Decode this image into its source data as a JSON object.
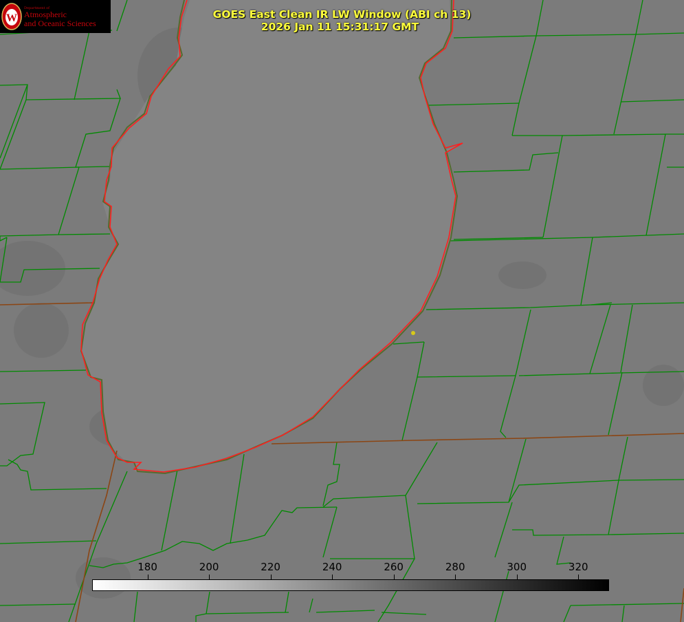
{
  "logo": {
    "department": "Department of",
    "line1": "Atmospheric",
    "line2": "and Oceanic Sciences",
    "seal_letter": "W",
    "seal_icon": "uw-crest-icon",
    "colors": {
      "background": "#000000",
      "text": "#c5050c",
      "seal": "#c5050c",
      "seal_gold": "#d9b65a"
    }
  },
  "title": {
    "line1": "GOES East Clean IR LW Window (ABI ch 13)",
    "line2": "2026 Jan 11 15:31:17 GMT",
    "color": "#ffff3c"
  },
  "colorbar": {
    "min": 162,
    "max": 330,
    "ticks": [
      180,
      200,
      220,
      240,
      260,
      280,
      300,
      320
    ],
    "scale": "white-to-black grayscale"
  },
  "map": {
    "background_color": "#7d7d7d",
    "lake_color": "#848484",
    "county_line_color": "#008000",
    "state_line_color": "#8b4513",
    "coastline_color": "#ff1a1a",
    "marker_color": "#d7c91a"
  }
}
